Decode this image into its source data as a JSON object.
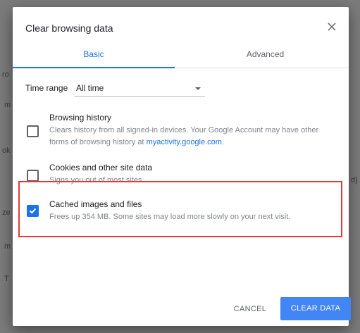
{
  "background": {
    "fragments": [
      "ro",
      "m",
      "ok",
      "ze",
      "m",
      "T",
      "d)"
    ]
  },
  "dialog": {
    "title": "Clear browsing data",
    "close_icon": "close-icon",
    "tabs": [
      {
        "label": "Basic",
        "selected": true
      },
      {
        "label": "Advanced",
        "selected": false
      }
    ],
    "time_range": {
      "label": "Time range",
      "value": "All time"
    },
    "options": [
      {
        "title": "Browsing history",
        "desc_prefix": "Clears history from all signed-in devices. Your Google Account may have other forms of browsing history at ",
        "link": "myactivity.google.com",
        "desc_suffix": ".",
        "checked": false
      },
      {
        "title": "Cookies and other site data",
        "desc": "Signs you out of most sites.",
        "checked": false
      },
      {
        "title": "Cached images and files",
        "desc": "Frees up 354 MB. Some sites may load more slowly on your next visit.",
        "checked": true
      }
    ],
    "buttons": {
      "cancel": "CANCEL",
      "clear": "CLEAR DATA"
    }
  },
  "colors": {
    "accent": "#1a73e8",
    "primary_button": "#4285f4",
    "highlight_border": "#e53935",
    "overlay": "#6e6e6e"
  }
}
